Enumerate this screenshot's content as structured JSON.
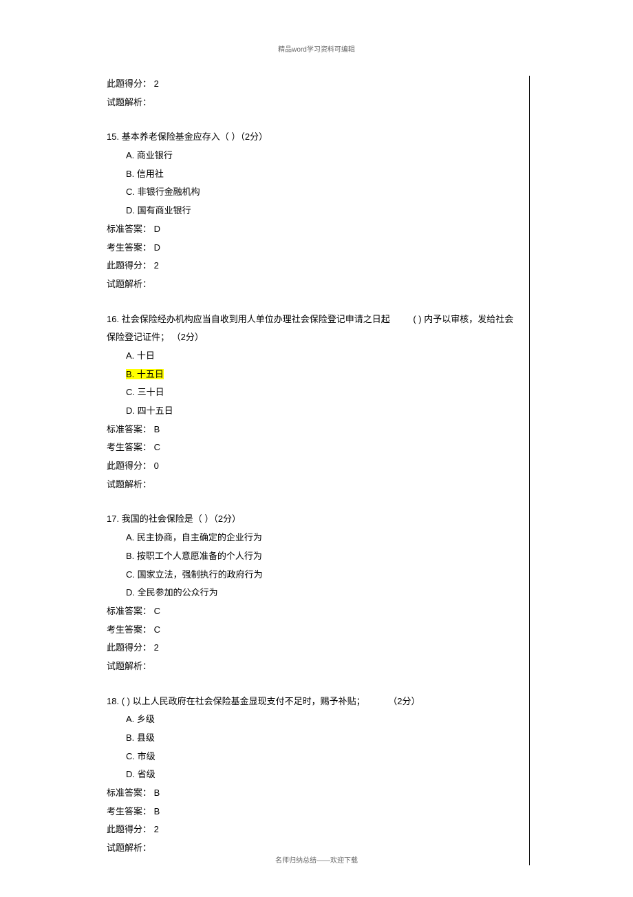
{
  "header": "精品word学习资料可编辑",
  "footer": "名师归纳总结——欢迎下载",
  "prev_tail": {
    "score_line": "此题得分：  2",
    "analysis_line": "试题解析："
  },
  "questions": [
    {
      "number": "15.",
      "stem": "基本养老保险基金应存入（      ）（2分）",
      "options": [
        "A. 商业银行",
        "B. 信用社",
        "C. 非银行金融机构",
        "D. 国有商业银行"
      ],
      "standard_answer": "标准答案：  D",
      "student_answer": "考生答案：  D",
      "score": "此题得分：  2",
      "analysis": "试题解析：",
      "highlight_index": -1
    },
    {
      "number": "16.",
      "stem_part1": "社会保险经办机构应当自收到用人单位办理社会保险登记申请之日起",
      "stem_part2": "(  )   内予以审核，发给社会",
      "stem_line2": "保险登记证件；  （2分）",
      "options": [
        "A. 十日",
        "B. 十五日",
        "C. 三十日",
        "D. 四十五日"
      ],
      "standard_answer": "标准答案：  B",
      "student_answer": "考生答案：  C",
      "score": "此题得分：  0",
      "analysis": "试题解析：",
      "highlight_index": 1
    },
    {
      "number": "17.",
      "stem": "我国的社会保险是（     ）（2分）",
      "options": [
        "A. 民主协商，自主确定的企业行为",
        "B. 按职工个人意愿准备的个人行为",
        "C. 国家立法，强制执行的政府行为",
        "D. 全民参加的公众行为"
      ],
      "standard_answer": "标准答案：  C",
      "student_answer": "考生答案：  C",
      "score": "此题得分：  2",
      "analysis": "试题解析：",
      "highlight_index": -1
    },
    {
      "number": "18.",
      "stem_part1": "(  )    以上人民政府在社会保险基金显现支付不足时，赐予补贴；",
      "stem_part2": "（2分）",
      "options": [
        "A. 乡级",
        "B. 县级",
        "C. 市级",
        "D. 省级"
      ],
      "standard_answer": "标准答案：  B",
      "student_answer": "考生答案：  B",
      "score": "此题得分：  2",
      "analysis": "试题解析：",
      "highlight_index": -1
    }
  ]
}
